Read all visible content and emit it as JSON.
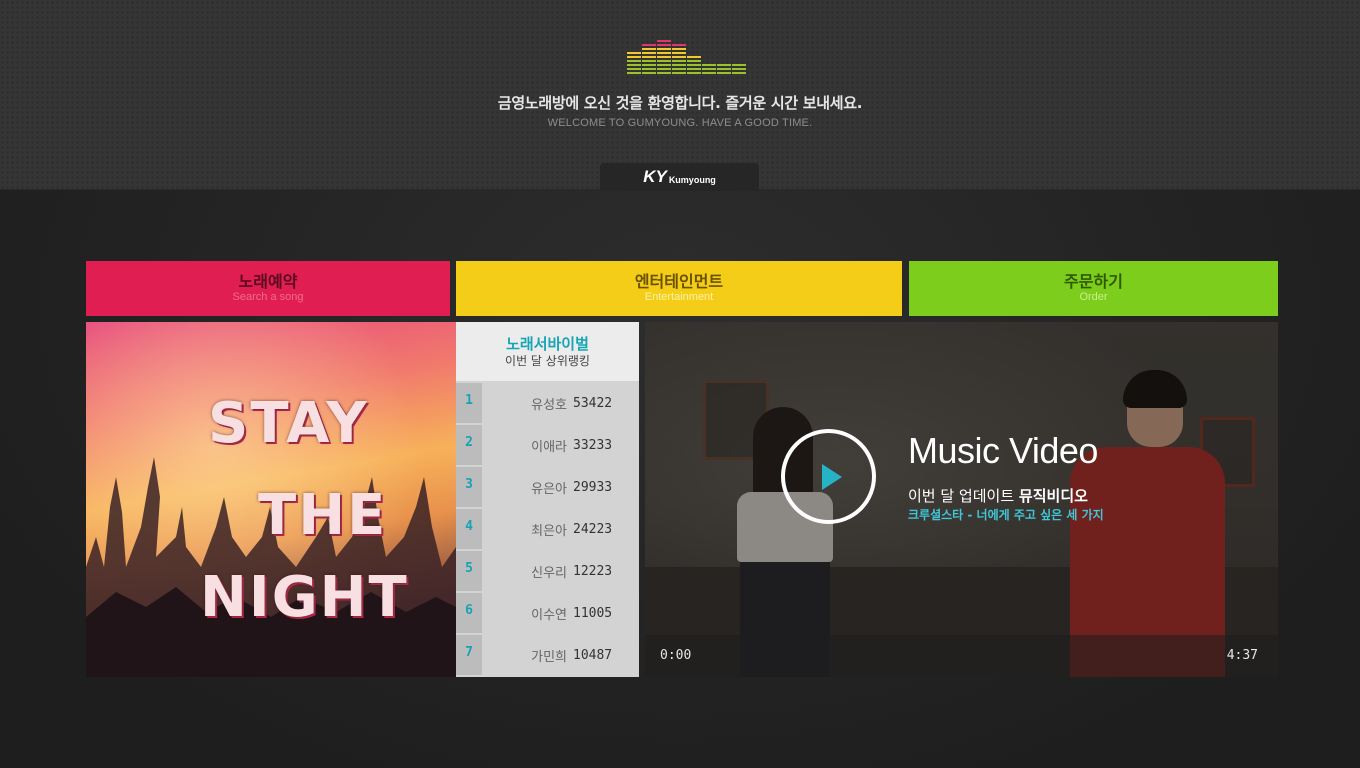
{
  "header": {
    "welcome_ko": "금영노래방에 오신 것을 환영합니다. 즐거운 시간 보내세요.",
    "welcome_en": "WELCOME TO  GUMYOUNG. HAVE A GOOD TIME.",
    "brand_ky": "KY",
    "brand_name": "Kumyoung",
    "eq_colors": {
      "top": "#e0366a",
      "mid": "#f2c82c",
      "low": "#9cc22a"
    }
  },
  "menu": {
    "song": {
      "ko": "노래예약",
      "en": "Search a song",
      "color": "#e11e52"
    },
    "entertainment": {
      "ko": "엔터테인먼트",
      "en": "Entertainment",
      "color": "#f3cd18"
    },
    "order": {
      "ko": "주문하기",
      "en": "Order",
      "color": "#7ccd1c"
    }
  },
  "album": {
    "line1": "STAY",
    "line2": "THE",
    "line3": "NIGHT"
  },
  "ranking": {
    "title": "노래서바이벌",
    "subtitle": "이번 달 상위랭킹",
    "accent": "#17a5b6",
    "rows": [
      {
        "rank": "1",
        "name": "유성호",
        "score": "53422"
      },
      {
        "rank": "2",
        "name": "이애라",
        "score": "33233"
      },
      {
        "rank": "3",
        "name": "유은아",
        "score": "29933"
      },
      {
        "rank": "4",
        "name": "최은아",
        "score": "24223"
      },
      {
        "rank": "5",
        "name": "신우리",
        "score": "12223"
      },
      {
        "rank": "6",
        "name": "이수연",
        "score": "11005"
      },
      {
        "rank": "7",
        "name": "가민희",
        "score": "10487"
      }
    ]
  },
  "video": {
    "title": "Music Video",
    "subtitle_prefix": "이번 달 업데이트",
    "subtitle_bold": "뮤직비디오",
    "song": "크루셜스타 - 너에게 주고 싶은 세 가지",
    "time_current": "0:00",
    "time_total": "4:37",
    "play_icon": "play-icon"
  }
}
